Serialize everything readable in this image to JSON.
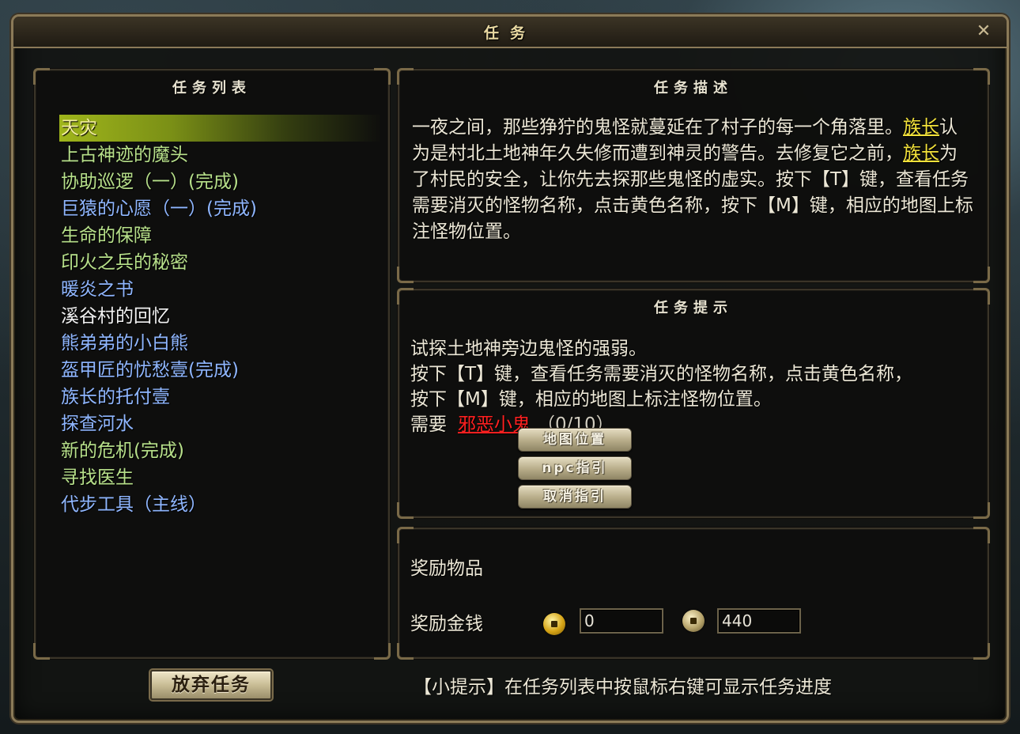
{
  "window": {
    "title": "任务",
    "close_icon": "close-icon"
  },
  "quest_list": {
    "header": "任务列表",
    "items": [
      {
        "label": "天灾",
        "color": "#f4f0a0",
        "selected": true
      },
      {
        "label": "上古神迹的魔头",
        "color": "#b7e08a"
      },
      {
        "label": "协助巡逻（一）(完成)",
        "color": "#b7e08a"
      },
      {
        "label": "巨猿的心愿（一）(完成)",
        "color": "#8fb6ff"
      },
      {
        "label": "生命的保障",
        "color": "#b7e08a"
      },
      {
        "label": "印火之兵的秘密",
        "color": "#b7e08a"
      },
      {
        "label": "暖炎之书",
        "color": "#8fb6ff"
      },
      {
        "label": "溪谷村的回忆",
        "color": "#f2f2f2"
      },
      {
        "label": "熊弟弟的小白熊",
        "color": "#8fb6ff"
      },
      {
        "label": "盔甲匠的忧愁壹(完成)",
        "color": "#8fb6ff"
      },
      {
        "label": "族长的托付壹",
        "color": "#8fb6ff"
      },
      {
        "label": "探查河水",
        "color": "#8fb6ff"
      },
      {
        "label": "新的危机(完成)",
        "color": "#b7e08a"
      },
      {
        "label": "寻找医生",
        "color": "#b7e08a"
      },
      {
        "label": "代步工具（主线）",
        "color": "#8fb6ff"
      }
    ]
  },
  "description": {
    "header": "任务描述",
    "p1": "一夜之间，那些狰狞的鬼怪就蔓延在了村子的每一个角落里。",
    "link1": "族长",
    "p2": "认为是村北土地神年久失修而遭到神灵的警告。去修复它之前，",
    "link2": "族长",
    "p3": "为了村民的安全，让你先去探那些鬼怪的虚实。按下【T】键，查看任务需要消灭的怪物名称，点击黄色名称，按下【M】键，相应的地图上标注怪物位置。"
  },
  "hint": {
    "header": "任务提示",
    "line1": "试探土地神旁边鬼怪的强弱。",
    "line2": "按下【T】键，查看任务需要消灭的怪物名称，点击黄色名称，",
    "line3": "按下【M】键，相应的地图上标注怪物位置。",
    "need_label": "需要",
    "monster": "邪恶小鬼",
    "progress": "（0/10）",
    "buttons": {
      "map": "地图位置",
      "npc": "npc指引",
      "cancel": "取消指引"
    }
  },
  "reward": {
    "items_label": "奖励物品",
    "money_label": "奖励金钱",
    "gold_value": "0",
    "silver_value": "440"
  },
  "footer": {
    "abandon": "放弃任务",
    "tip": "【小提示】在任务列表中按鼠标右键可显示任务进度"
  },
  "colors": {
    "accent": "#8b7a58",
    "selected": "#9fb51b",
    "highlight": "#f3e23a",
    "monster": "#ff2020"
  }
}
